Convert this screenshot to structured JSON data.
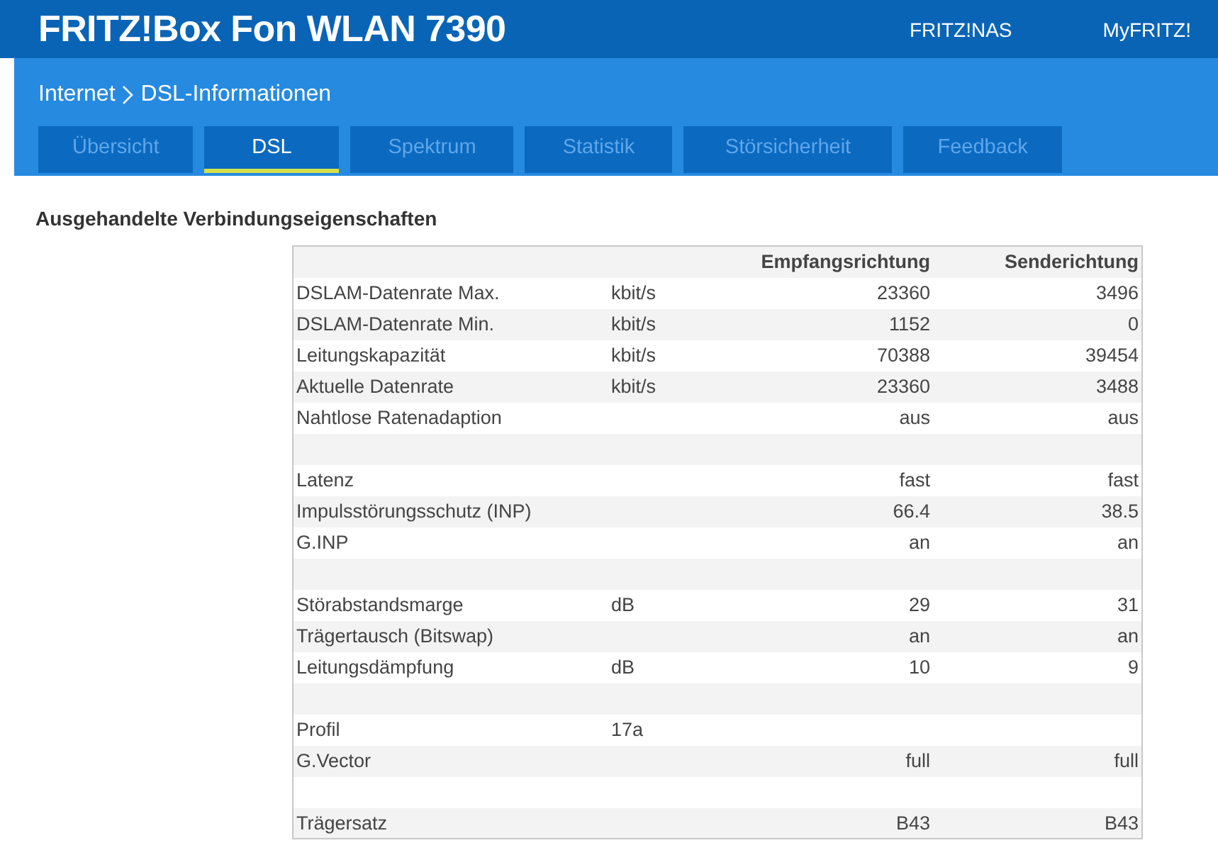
{
  "header": {
    "title": "FRITZ!Box Fon WLAN 7390",
    "links": [
      "FRITZ!NAS",
      "MyFRITZ!"
    ]
  },
  "breadcrumb": [
    "Internet",
    "DSL-Informationen"
  ],
  "tabs": [
    {
      "label": "Übersicht",
      "selected": false
    },
    {
      "label": "DSL",
      "selected": true
    },
    {
      "label": "Spektrum",
      "selected": false
    },
    {
      "label": "Statistik",
      "selected": false
    },
    {
      "label": "Störsicherheit",
      "selected": false
    },
    {
      "label": "Feedback",
      "selected": false
    }
  ],
  "section_title": "Ausgehandelte Verbindungseigenschaften",
  "table": {
    "columns": [
      "Empfangsrichtung",
      "Senderichtung"
    ],
    "rows": [
      {
        "kind": "data",
        "label": "DSLAM-Datenrate Max.",
        "unit": "kbit/s",
        "down": "23360",
        "up": "3496"
      },
      {
        "kind": "data",
        "label": "DSLAM-Datenrate Min.",
        "unit": "kbit/s",
        "down": "1152",
        "up": "0"
      },
      {
        "kind": "data",
        "label": "Leitungskapazität",
        "unit": "kbit/s",
        "down": "70388",
        "up": "39454"
      },
      {
        "kind": "data",
        "label": "Aktuelle Datenrate",
        "unit": "kbit/s",
        "down": "23360",
        "up": "3488"
      },
      {
        "kind": "data",
        "label": "Nahtlose Ratenadaption",
        "down": "aus",
        "up": "aus"
      },
      {
        "kind": "spacer"
      },
      {
        "kind": "data",
        "label": "Latenz",
        "down": "fast",
        "up": "fast"
      },
      {
        "kind": "data",
        "label": "Impulsstörungsschutz (INP)",
        "down": "66.4",
        "up": "38.5"
      },
      {
        "kind": "data",
        "label": "G.INP",
        "down": "an",
        "up": "an"
      },
      {
        "kind": "spacer"
      },
      {
        "kind": "data",
        "label": "Störabstandsmarge",
        "unit": "dB",
        "down": "29",
        "up": "31"
      },
      {
        "kind": "data",
        "label": "Trägertausch (Bitswap)",
        "down": "an",
        "up": "an"
      },
      {
        "kind": "data",
        "label": "Leitungsdämpfung",
        "unit": "dB",
        "down": "10",
        "up": "9"
      },
      {
        "kind": "spacer"
      },
      {
        "kind": "data",
        "label": "Profil",
        "unit": "17a"
      },
      {
        "kind": "data",
        "label": "G.Vector",
        "down": "full",
        "up": "full"
      },
      {
        "kind": "spacer"
      },
      {
        "kind": "data",
        "label": "Trägersatz",
        "down": "B43",
        "up": "B43"
      }
    ]
  }
}
